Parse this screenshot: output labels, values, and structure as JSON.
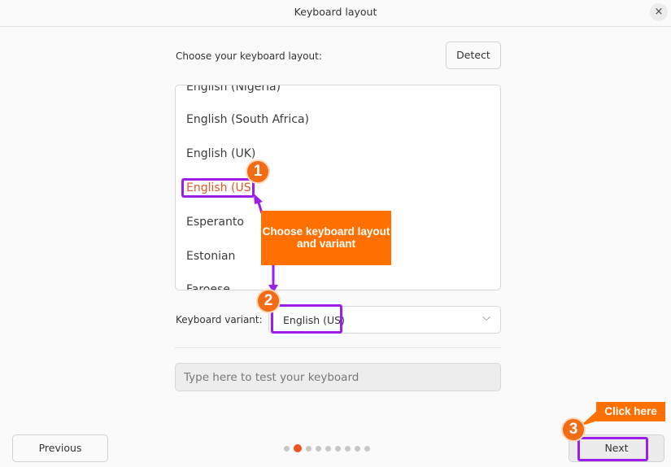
{
  "window": {
    "title": "Keyboard layout",
    "close_icon": "close-icon",
    "close_glyph": "×"
  },
  "layout": {
    "prompt": "Choose your keyboard layout:",
    "detect_label": "Detect",
    "items": [
      "English (Nigeria)",
      "English (South Africa)",
      "English (UK)",
      "English (US)",
      "Esperanto",
      "Estonian",
      "Faroese"
    ],
    "selected": "English (US)"
  },
  "variant": {
    "label": "Keyboard variant:",
    "value": "English (US)",
    "chevron_icon": "chevron-down-icon",
    "chevron_glyph": "⌵"
  },
  "test": {
    "placeholder": "Type here to test your keyboard"
  },
  "footer": {
    "previous_label": "Previous",
    "next_label": "Next",
    "step_current": 2,
    "step_total": 9
  },
  "annotations": {
    "badge1": "1",
    "badge2": "2",
    "badge3": "3",
    "callout": "Choose keyboard layout and variant",
    "click_here": "Click here",
    "accent_color": "#ff7000",
    "highlight_color": "#9b1fe8"
  },
  "colors": {
    "ubuntu_orange": "#e95420",
    "background": "#fafafa"
  }
}
